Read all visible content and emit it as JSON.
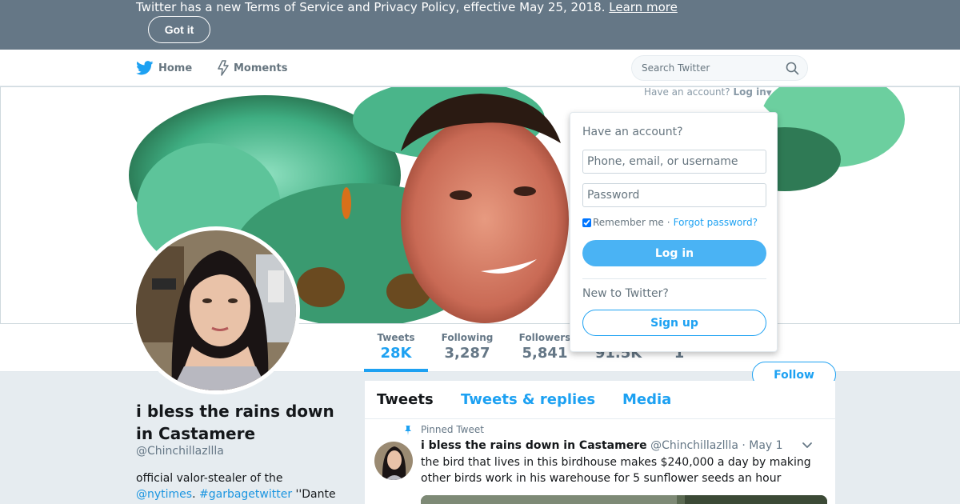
{
  "notice": {
    "text": "Twitter has a new Terms of Service and Privacy Policy, effective May 25, 2018.",
    "link": "Learn more",
    "button": "Got it"
  },
  "nav": {
    "home": "Home",
    "moments": "Moments",
    "search_placeholder": "Search Twitter",
    "account_prompt": "Have an account?",
    "login_link": "Log in"
  },
  "login_dropdown": {
    "title": "Have an account?",
    "username_placeholder": "Phone, email, or username",
    "password_placeholder": "Password",
    "remember": "Remember me",
    "separator": "·",
    "forgot": "Forgot password?",
    "login_button": "Log in",
    "new_prompt": "New to Twitter?",
    "signup_button": "Sign up"
  },
  "stats": [
    {
      "label": "Tweets",
      "value": "28K"
    },
    {
      "label": "Following",
      "value": "3,287"
    },
    {
      "label": "Followers",
      "value": "5,841"
    },
    {
      "label": "",
      "value": "91.5K"
    },
    {
      "label": "",
      "value": "1"
    }
  ],
  "follow_button": "Follow",
  "profile": {
    "name": "i bless the rains down in Castamere",
    "handle": "@Chinchillazllla",
    "bio_text": "official valor-stealer of the",
    "bio_link1": "@nytimes",
    "bio_sep": ". ",
    "bio_link2": "#garbagetwitter",
    "bio_tail": " ''Dante"
  },
  "tabs": [
    "Tweets",
    "Tweets & replies",
    "Media"
  ],
  "tweet": {
    "pinned": "Pinned Tweet",
    "name": "i bless the rains down in Castamere",
    "handle": "@Chinchillazllla",
    "date": "· May 1",
    "text": "the bird that lives in this birdhouse makes $240,000 a day by making other birds work in his warehouse for 5 sunflower seeds an hour"
  },
  "colors": {
    "accent": "#1da1f2",
    "banner_notice": "#657786"
  }
}
